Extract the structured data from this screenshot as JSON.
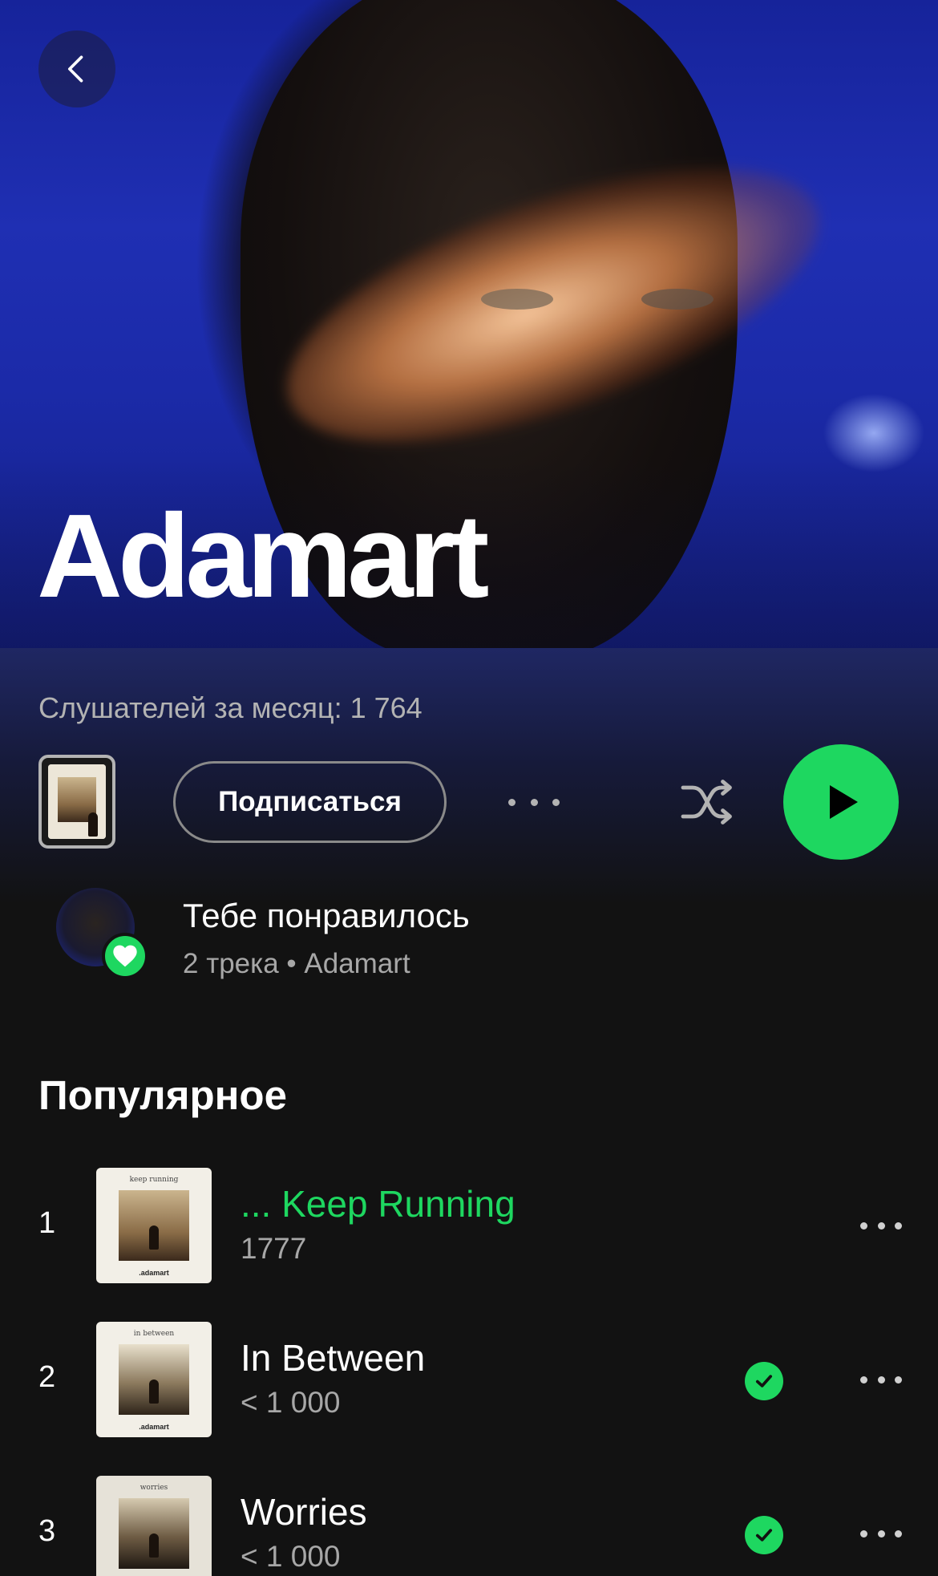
{
  "artist": {
    "name": "Adamart",
    "monthly_listeners": "Слушателей за месяц: 1 764"
  },
  "actions": {
    "follow_label": "Подписаться",
    "cover_icon": "album-cover",
    "more_icon": "more-horizontal-icon",
    "shuffle_icon": "shuffle-icon",
    "play_icon": "play-icon"
  },
  "liked": {
    "title": "Тебе понравилось",
    "subtitle": "2 трека • Adamart"
  },
  "popular": {
    "heading": "Популярное",
    "tracks": [
      {
        "number": "1",
        "title": "... Keep Running",
        "plays": "1777",
        "cover_caption": "keep running",
        "cover_brand": ".adamart",
        "active": true,
        "downloaded": false
      },
      {
        "number": "2",
        "title": "In Between",
        "plays": "< 1 000",
        "cover_caption": "in between",
        "cover_brand": ".adamart",
        "active": false,
        "downloaded": true
      },
      {
        "number": "3",
        "title": "Worries",
        "plays": "< 1 000",
        "cover_caption": "worries",
        "cover_brand": "",
        "active": false,
        "downloaded": true
      }
    ]
  },
  "colors": {
    "accent": "#1ed760",
    "background": "#121212",
    "hero_blue": "#1f2fb3"
  }
}
